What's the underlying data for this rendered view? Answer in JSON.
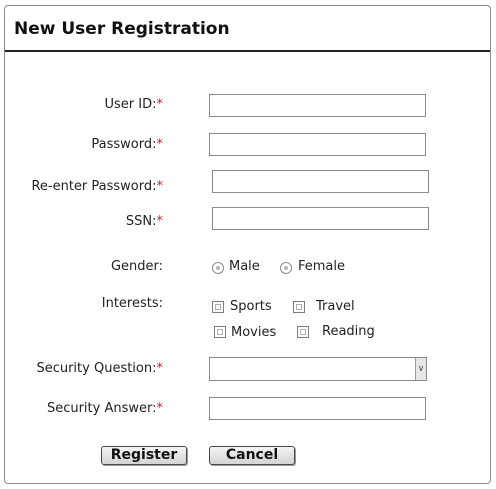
{
  "form": {
    "title": "New User Registration",
    "required_mark": "*",
    "user_id": {
      "label": "User ID:",
      "value": ""
    },
    "password": {
      "label": "Password:",
      "value": ""
    },
    "reenter_password": {
      "label": "Re-enter Password:",
      "value": ""
    },
    "ssn": {
      "label": "SSN:",
      "value": ""
    },
    "gender": {
      "label": "Gender:",
      "options": [
        "Male",
        "Female"
      ]
    },
    "interests": {
      "label": "Interests:",
      "options": [
        "Sports",
        "Travel",
        "Movies",
        "Reading"
      ]
    },
    "security_question": {
      "label": "Security Question:",
      "selected": ""
    },
    "security_answer": {
      "label": "Security Answer:",
      "value": ""
    },
    "buttons": {
      "register": "Register",
      "cancel": "Cancel"
    }
  },
  "colors": {
    "required": "#d21f1f",
    "header_rule": "#222222"
  },
  "icons": {
    "dropdown": "chevron-down-icon"
  }
}
